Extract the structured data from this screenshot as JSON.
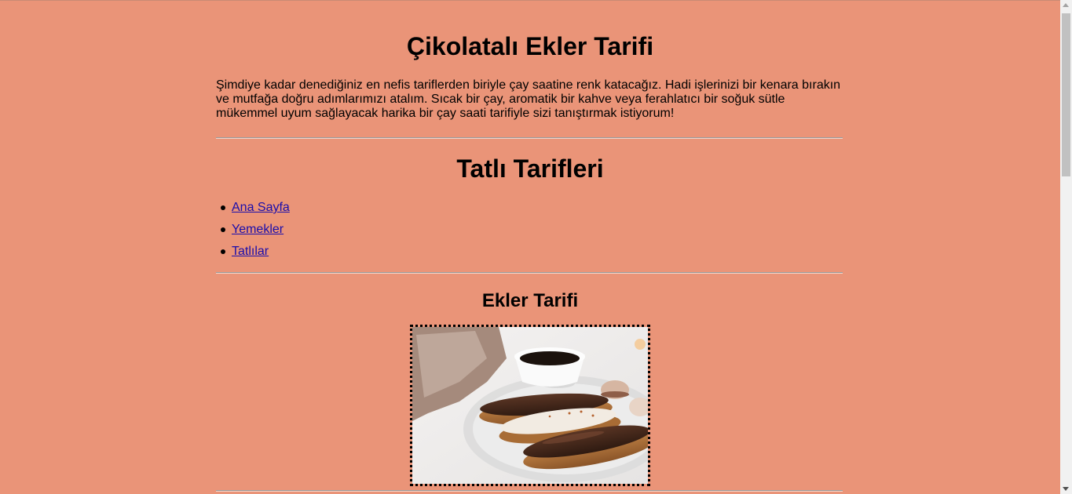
{
  "header": {
    "title": "Çikolatalı Ekler Tarifi",
    "intro": "Şimdiye kadar denediğiniz en nefis tariflerden biriyle çay saatine renk katacağız. Hadi işlerinizi bir kenara bırakın ve mutfağa doğru adımlarımızı atalım. Sıcak bir çay, aromatik bir kahve veya ferahlatıcı bir soğuk sütle mükemmel uyum sağlayacak harika bir çay saati tarifiyle sizi tanıştırmak istiyorum!"
  },
  "nav": {
    "heading": "Tatlı Tarifleri",
    "items": [
      {
        "label": "Ana Sayfa"
      },
      {
        "label": "Yemekler"
      },
      {
        "label": "Tatlılar"
      }
    ]
  },
  "recipe": {
    "heading": "Ekler Tarifi"
  },
  "colors": {
    "background": "#ea9478",
    "link": "#1a0dab"
  }
}
